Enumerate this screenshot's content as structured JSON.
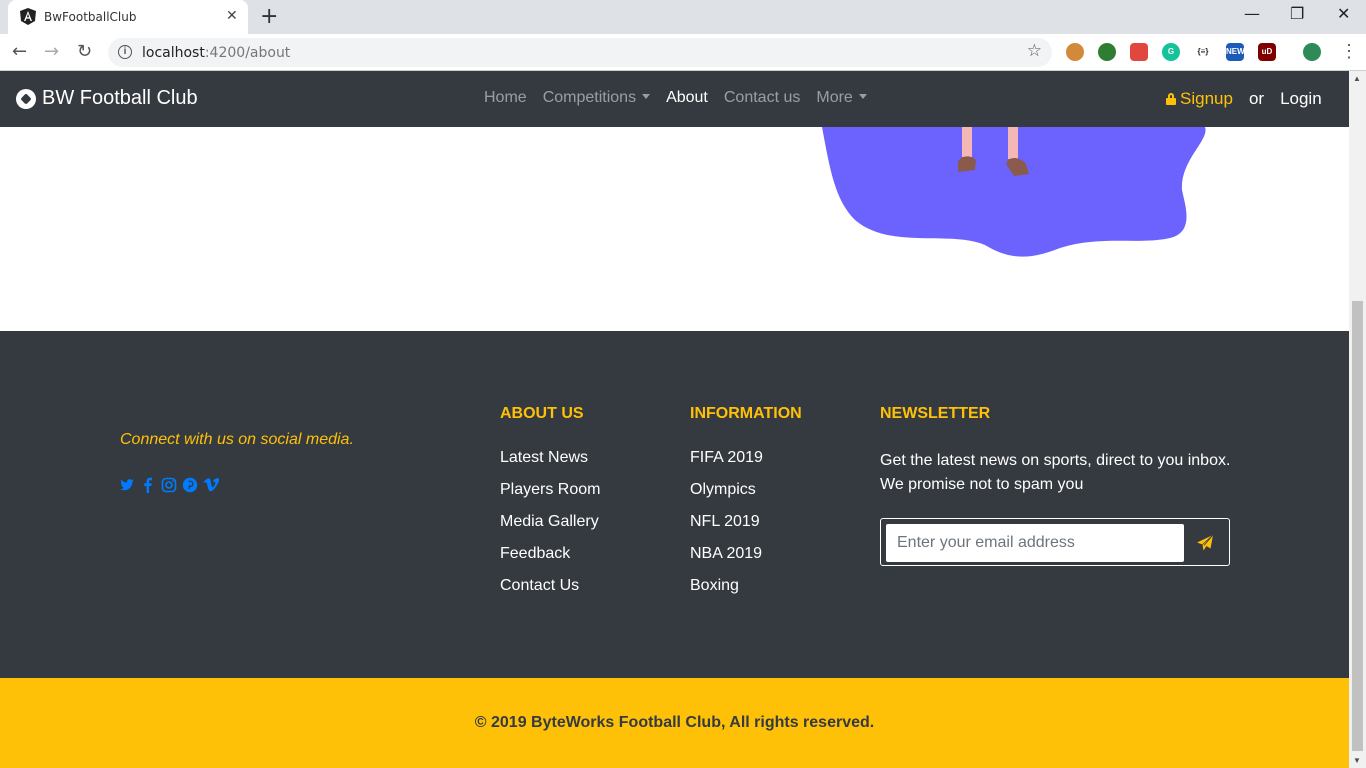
{
  "browser": {
    "tab_title": "BwFootballClub",
    "tab_close": "✕",
    "new_tab": "+",
    "url_host": "localhost",
    "url_path": ":4200/about",
    "minimize": "—",
    "restore": "❐",
    "close": "✕",
    "extensions": [
      {
        "name": "cookie-extension-icon",
        "color": "#d28a3a",
        "label": ""
      },
      {
        "name": "globe-extension-icon",
        "color": "#2e7d32",
        "label": ""
      },
      {
        "name": "pocket-extension-icon",
        "color": "#e2473d",
        "label": ""
      },
      {
        "name": "grammarly-extension-icon",
        "color": "#15c39a",
        "label": "G"
      },
      {
        "name": "json-extension-icon",
        "color": "#ffffff",
        "label": "{≡}"
      },
      {
        "name": "new-extension-icon",
        "color": "#1e5bb8",
        "label": "NEW"
      },
      {
        "name": "ublock-extension-icon",
        "color": "#800000",
        "label": "uD"
      },
      {
        "name": "profile-avatar-icon",
        "color": "#2e8b57",
        "label": ""
      }
    ]
  },
  "navbar": {
    "brand": "BW Football Club",
    "links": {
      "home": "Home",
      "competitions": "Competitions",
      "about": "About",
      "contact": "Contact us",
      "more": "More"
    },
    "signup": "Signup",
    "or": "or",
    "login": "Login"
  },
  "colors": {
    "accent": "#ffc107",
    "dark": "#343a40",
    "illustration": "#6c63ff"
  },
  "footer": {
    "connect": "Connect with us on social media.",
    "socials": [
      "twitter-icon",
      "facebook-icon",
      "instagram-icon",
      "pinterest-icon",
      "vimeo-icon"
    ],
    "about": {
      "title": "ABOUT US",
      "items": [
        "Latest News",
        "Players Room",
        "Media Gallery",
        "Feedback",
        "Contact Us"
      ]
    },
    "information": {
      "title": "INFORMATION",
      "items": [
        "FIFA 2019",
        "Olympics",
        "NFL 2019",
        "NBA 2019",
        "Boxing"
      ]
    },
    "newsletter": {
      "title": "NEWSLETTER",
      "text": "Get the latest news on sports, direct to you inbox. We promise not to spam you",
      "placeholder": "Enter your email address"
    }
  },
  "copyright": "© 2019 ByteWorks Football Club, All rights reserved."
}
